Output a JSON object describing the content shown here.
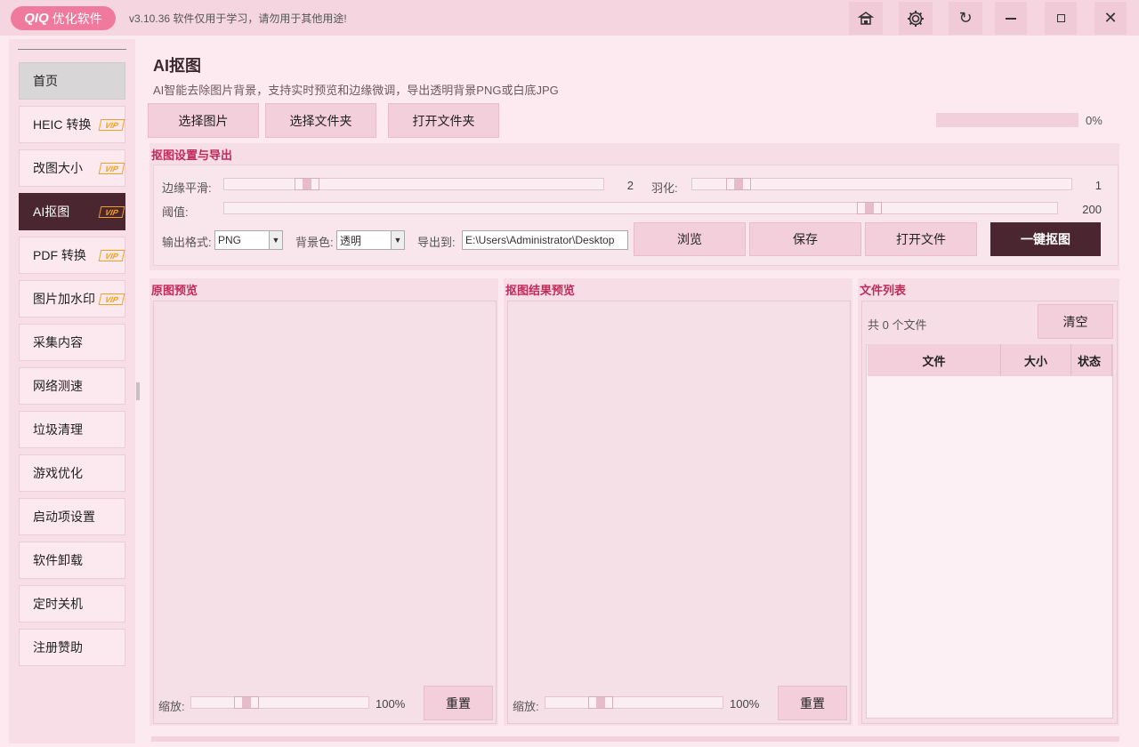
{
  "app": {
    "logo_brand": "QIQ",
    "logo_text": "优化软件",
    "version_text": "v3.10.36  软件仅用于学习，请勿用于其他用途!"
  },
  "titlebar_buttons": {
    "hat": "hat-icon",
    "settings": "gear-icon",
    "refresh": "refresh-icon",
    "minimize": "minimize-icon",
    "maximize": "maximize-icon",
    "close": "close-icon"
  },
  "sidebar": {
    "items": [
      {
        "label": "首页",
        "vip": false
      },
      {
        "label": "HEIC 转换",
        "vip": true
      },
      {
        "label": "改图大小",
        "vip": true
      },
      {
        "label": "AI抠图",
        "vip": true
      },
      {
        "label": "PDF 转换",
        "vip": true
      },
      {
        "label": "图片加水印",
        "vip": true
      },
      {
        "label": "采集内容",
        "vip": false
      },
      {
        "label": "网络测速",
        "vip": false
      },
      {
        "label": "垃圾清理",
        "vip": false
      },
      {
        "label": "游戏优化",
        "vip": false
      },
      {
        "label": "启动项设置",
        "vip": false
      },
      {
        "label": "软件卸载",
        "vip": false
      },
      {
        "label": "定时关机",
        "vip": false
      },
      {
        "label": "注册赞助",
        "vip": false
      }
    ],
    "vip_label": "VIP",
    "active_index": 3
  },
  "page": {
    "title": "AI抠图",
    "subtitle": "AI智能去除图片背景，支持实时预览和边缘微调，导出透明背景PNG或白底JPG"
  },
  "toolbar": {
    "select_image": "选择图片",
    "select_folder": "选择文件夹",
    "open_folder": "打开文件夹",
    "progress_value": 0,
    "progress_text": "0%"
  },
  "settings": {
    "title": "抠图设置与导出",
    "edge_smooth_label": "边缘平滑:",
    "edge_smooth_value": "2",
    "feather_label": "羽化:",
    "feather_value": "1",
    "threshold_label": "阈值:",
    "threshold_value": "200",
    "format_label": "输出格式:",
    "format_value": "PNG",
    "bg_label": "背景色:",
    "bg_value": "透明",
    "export_label": "导出到:",
    "export_path": "E:\\Users\\Administrator\\Desktop",
    "browse": "浏览",
    "save": "保存",
    "open_file": "打开文件",
    "one_click": "一键抠图"
  },
  "original_preview": {
    "title": "原图预览",
    "zoom_label": "缩放:",
    "zoom_value": "100%",
    "reset": "重置"
  },
  "result_preview": {
    "title": "抠图结果预览",
    "zoom_label": "缩放:",
    "zoom_value": "100%",
    "reset": "重置"
  },
  "file_list": {
    "title": "文件列表",
    "count_text": "共 0 个文件",
    "clear": "清空",
    "columns": [
      "文件",
      "大小",
      "状态"
    ]
  }
}
